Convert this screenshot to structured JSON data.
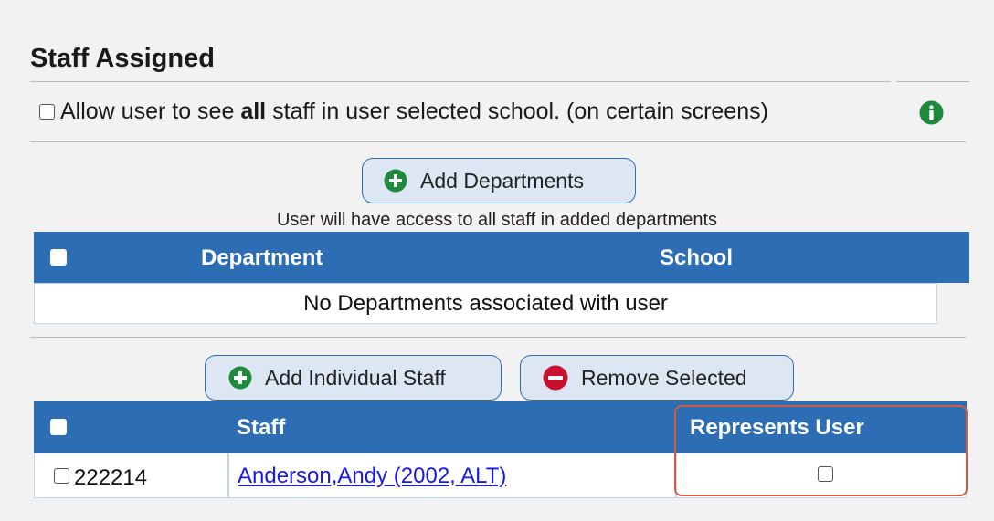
{
  "section": {
    "title": "Staff Assigned"
  },
  "allow_option": {
    "prefix": "Allow user to see ",
    "bold": "all",
    "suffix": " staff in user selected school. (on certain screens)",
    "checked": false
  },
  "departments": {
    "add_button": "Add Departments",
    "hint": "User will have access to all staff in added departments",
    "columns": [
      "Department",
      "School"
    ],
    "empty_message": "No Departments associated with user"
  },
  "staff": {
    "add_button": "Add Individual Staff",
    "remove_button": "Remove Selected",
    "columns": [
      "Staff",
      "Represents User"
    ],
    "rows": [
      {
        "id": "222214",
        "name": "Anderson,Andy (2002, ALT)",
        "checked": false,
        "represents_user": false
      }
    ]
  },
  "colors": {
    "header_blue": "#2d6db3",
    "add_green": "#1f8a3c",
    "remove_red": "#c8102e",
    "highlight": "#cf5c43"
  }
}
